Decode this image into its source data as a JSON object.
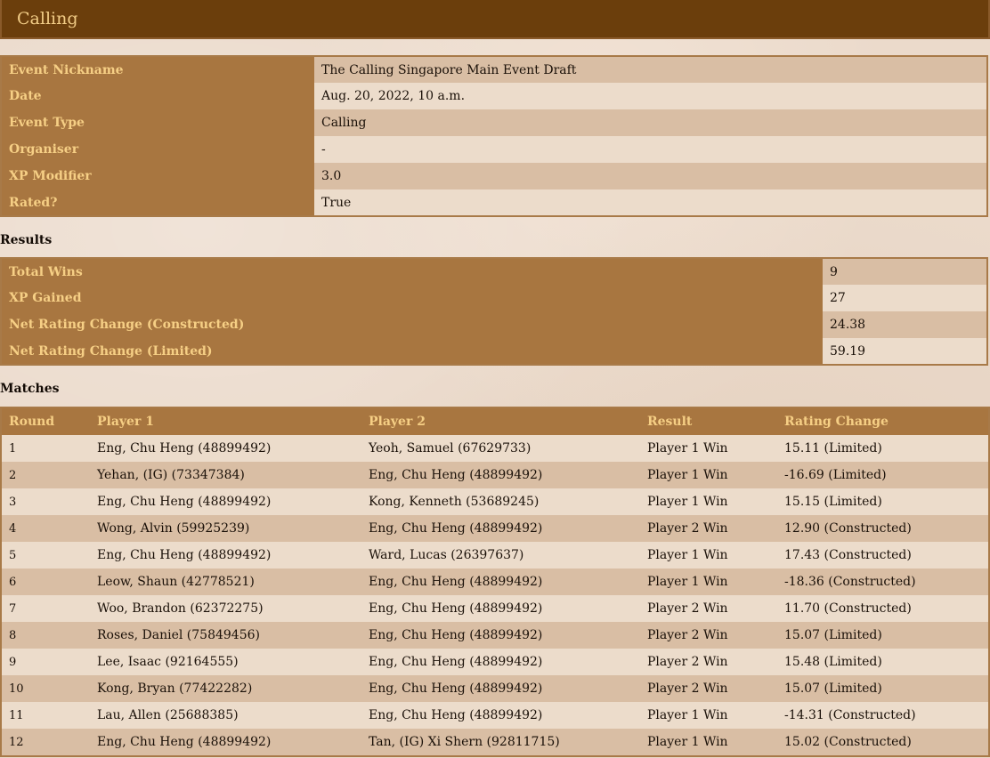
{
  "header": {
    "title": "Calling"
  },
  "event_info": [
    {
      "label": "Event Nickname",
      "value": "The Calling Singapore Main Event Draft"
    },
    {
      "label": "Date",
      "value": "Aug. 20, 2022, 10 a.m."
    },
    {
      "label": "Event Type",
      "value": "Calling"
    },
    {
      "label": "Organiser",
      "value": "-"
    },
    {
      "label": "XP Modifier",
      "value": "3.0"
    },
    {
      "label": "Rated?",
      "value": "True"
    }
  ],
  "results": {
    "heading": "Results",
    "rows": [
      {
        "label": "Total Wins",
        "value": "9"
      },
      {
        "label": "XP Gained",
        "value": "27"
      },
      {
        "label": "Net Rating Change (Constructed)",
        "value": "24.38"
      },
      {
        "label": "Net Rating Change (Limited)",
        "value": "59.19"
      }
    ]
  },
  "matches": {
    "heading": "Matches",
    "columns": [
      "Round",
      "Player 1",
      "Player 2",
      "Result",
      "Rating Change"
    ],
    "rows": [
      [
        "1",
        "Eng, Chu Heng (48899492)",
        "Yeoh, Samuel (67629733)",
        "Player 1 Win",
        "15.11 (Limited)"
      ],
      [
        "2",
        "Yehan, (IG) (73347384)",
        "Eng, Chu Heng (48899492)",
        "Player 1 Win",
        "-16.69 (Limited)"
      ],
      [
        "3",
        "Eng, Chu Heng (48899492)",
        "Kong, Kenneth (53689245)",
        "Player 1 Win",
        "15.15 (Limited)"
      ],
      [
        "4",
        "Wong, Alvin (59925239)",
        "Eng, Chu Heng (48899492)",
        "Player 2 Win",
        "12.90 (Constructed)"
      ],
      [
        "5",
        "Eng, Chu Heng (48899492)",
        "Ward, Lucas (26397637)",
        "Player 1 Win",
        "17.43 (Constructed)"
      ],
      [
        "6",
        "Leow, Shaun (42778521)",
        "Eng, Chu Heng (48899492)",
        "Player 1 Win",
        "-18.36 (Constructed)"
      ],
      [
        "7",
        "Woo, Brandon (62372275)",
        "Eng, Chu Heng (48899492)",
        "Player 2 Win",
        "11.70 (Constructed)"
      ],
      [
        "8",
        "Roses, Daniel (75849456)",
        "Eng, Chu Heng (48899492)",
        "Player 2 Win",
        "15.07 (Limited)"
      ],
      [
        "9",
        "Lee, Isaac (92164555)",
        "Eng, Chu Heng (48899492)",
        "Player 2 Win",
        "15.48 (Limited)"
      ],
      [
        "10",
        "Kong, Bryan (77422282)",
        "Eng, Chu Heng (48899492)",
        "Player 2 Win",
        "15.07 (Limited)"
      ],
      [
        "11",
        "Lau, Allen (25688385)",
        "Eng, Chu Heng (48899492)",
        "Player 1 Win",
        "-14.31 (Constructed)"
      ],
      [
        "12",
        "Eng, Chu Heng (48899492)",
        "Tan, (IG) Xi Shern (92811715)",
        "Player 1 Win",
        "15.02 (Constructed)"
      ]
    ]
  }
}
